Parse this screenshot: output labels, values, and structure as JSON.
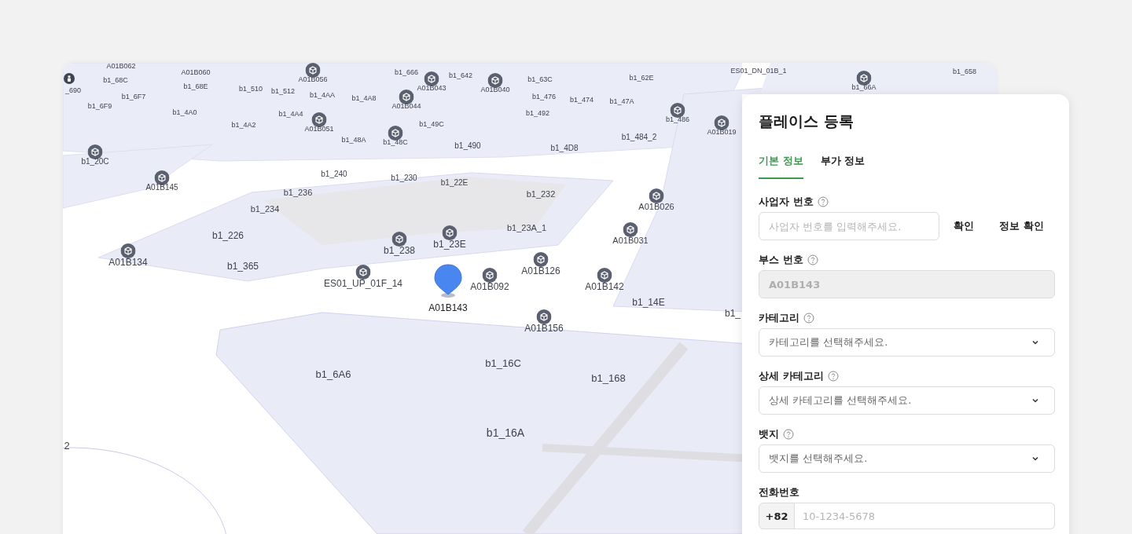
{
  "map": {
    "labels": [
      {
        "text": "A01B062",
        "pin": false
      },
      {
        "text": "A01B060",
        "pin": false
      },
      {
        "text": "b1_68C",
        "pin": false
      },
      {
        "text": "_690",
        "pin": false
      },
      {
        "text": "b1_68E",
        "pin": false
      },
      {
        "text": "b1_510",
        "pin": false
      },
      {
        "text": "b1_512",
        "pin": false
      },
      {
        "text": "b1_4AA",
        "pin": false
      },
      {
        "text": "b1_4A8",
        "pin": false
      },
      {
        "text": "b1_666",
        "pin": false
      },
      {
        "text": "b1_642",
        "pin": false
      },
      {
        "text": "b1_6F7",
        "pin": false
      },
      {
        "text": "b1_6F9",
        "pin": false
      },
      {
        "text": "b1_4A0",
        "pin": false
      },
      {
        "text": "b1_4A4",
        "pin": false
      },
      {
        "text": "b1_4A2",
        "pin": false
      },
      {
        "text": "b1_48A",
        "pin": false
      },
      {
        "text": "b1_49C",
        "pin": false
      },
      {
        "text": "b1_63C",
        "pin": false
      },
      {
        "text": "b1_476",
        "pin": false
      },
      {
        "text": "b1_474",
        "pin": false
      },
      {
        "text": "b1_47A",
        "pin": false
      },
      {
        "text": "b1_62E",
        "pin": false
      },
      {
        "text": "ES01_DN_01B_1",
        "pin": false
      },
      {
        "text": "b1_658",
        "pin": false
      },
      {
        "text": "b1_492",
        "pin": false
      },
      {
        "text": "b1_490",
        "pin": false
      },
      {
        "text": "b1_4D8",
        "pin": false
      },
      {
        "text": "b1_484_2",
        "pin": false
      },
      {
        "text": "b1_240",
        "pin": false
      },
      {
        "text": "b1_230",
        "pin": false
      },
      {
        "text": "b1_236",
        "pin": false
      },
      {
        "text": "b1_22E",
        "pin": false
      },
      {
        "text": "b1_232",
        "pin": false
      },
      {
        "text": "b1_234",
        "pin": false
      },
      {
        "text": "b1_226",
        "pin": false
      },
      {
        "text": "b1_23A_1",
        "pin": false
      },
      {
        "text": "b1_365",
        "pin": false
      },
      {
        "text": "b1_14E",
        "pin": false
      },
      {
        "text": "b1_",
        "pin": false
      },
      {
        "text": "b1_6A6",
        "pin": false
      },
      {
        "text": "b1_16C",
        "pin": false
      },
      {
        "text": "b1_168",
        "pin": false
      },
      {
        "text": "b1_16A",
        "pin": false
      },
      {
        "text": "2",
        "pin": false
      },
      {
        "text": "A01B056",
        "pin": true
      },
      {
        "text": "A01B043",
        "pin": true
      },
      {
        "text": "A01B040",
        "pin": true
      },
      {
        "text": "A01B044",
        "pin": true
      },
      {
        "text": "A01B051",
        "pin": true
      },
      {
        "text": "b1_48C",
        "pin": true
      },
      {
        "text": "b1_486",
        "pin": true
      },
      {
        "text": "A01B019",
        "pin": true
      },
      {
        "text": "b1_66A",
        "pin": true
      },
      {
        "text": "b1_20C",
        "pin": true
      },
      {
        "text": "A01B145",
        "pin": true
      },
      {
        "text": "A01B134",
        "pin": true
      },
      {
        "text": "b1_238",
        "pin": true
      },
      {
        "text": "b1_23E",
        "pin": true
      },
      {
        "text": "ES01_UP_01F_14",
        "pin": true
      },
      {
        "text": "A01B092",
        "pin": true
      },
      {
        "text": "A01B126",
        "pin": true
      },
      {
        "text": "A01B026",
        "pin": true
      },
      {
        "text": "A01B031",
        "pin": true
      },
      {
        "text": "A01B142",
        "pin": true
      },
      {
        "text": "A01B156",
        "pin": true
      }
    ],
    "selected_marker": {
      "label": "A01B143"
    }
  },
  "panel": {
    "title": "플레이스 등록",
    "tabs": [
      {
        "label": "기본 정보",
        "selected": true
      },
      {
        "label": "부가 정보",
        "selected": false
      }
    ],
    "fields": [
      {
        "kind": "input-with-buttons",
        "label": "사업자 번호",
        "help": true,
        "placeholder": "사업자 번호를 입력해주세요.",
        "buttons": [
          "확인",
          "정보 확인"
        ]
      },
      {
        "kind": "readonly",
        "label": "부스 번호",
        "help": true,
        "value": "A01B143"
      },
      {
        "kind": "select",
        "label": "카테고리",
        "help": true,
        "placeholder": "카테고리를 선택해주세요."
      },
      {
        "kind": "select",
        "label": "상세 카테고리",
        "help": true,
        "placeholder": "상세 카테고리를 선택해주세요."
      },
      {
        "kind": "select",
        "label": "뱃지",
        "help": true,
        "placeholder": "뱃지를 선택해주세요."
      },
      {
        "kind": "phone",
        "label": "전화번호",
        "help": false,
        "prefix": "+82",
        "placeholder": "10-1234-5678"
      }
    ]
  }
}
